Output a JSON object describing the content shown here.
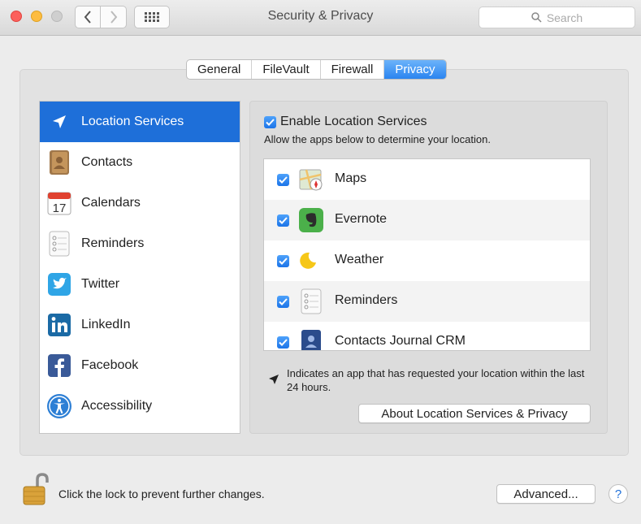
{
  "window": {
    "title": "Security & Privacy"
  },
  "search": {
    "placeholder": "Search"
  },
  "tabs": [
    {
      "label": "General",
      "active": false
    },
    {
      "label": "FileVault",
      "active": false
    },
    {
      "label": "Firewall",
      "active": false
    },
    {
      "label": "Privacy",
      "active": true
    }
  ],
  "sidebar": {
    "items": [
      {
        "label": "Location Services",
        "icon": "location-arrow-icon",
        "active": true
      },
      {
        "label": "Contacts",
        "icon": "contacts-book-icon",
        "active": false
      },
      {
        "label": "Calendars",
        "icon": "calendar-icon",
        "active": false
      },
      {
        "label": "Reminders",
        "icon": "reminders-icon",
        "active": false
      },
      {
        "label": "Twitter",
        "icon": "twitter-icon",
        "active": false
      },
      {
        "label": "LinkedIn",
        "icon": "linkedin-icon",
        "active": false
      },
      {
        "label": "Facebook",
        "icon": "facebook-icon",
        "active": false
      },
      {
        "label": "Accessibility",
        "icon": "accessibility-icon",
        "active": false
      }
    ],
    "calendar_day": "17"
  },
  "panel": {
    "enable_label": "Enable Location Services",
    "enable_checked": true,
    "subtitle": "Allow the apps below to determine your location.",
    "apps": [
      {
        "label": "Maps",
        "checked": true,
        "icon": "maps-icon"
      },
      {
        "label": "Evernote",
        "checked": true,
        "icon": "evernote-icon"
      },
      {
        "label": "Weather",
        "checked": true,
        "icon": "weather-icon"
      },
      {
        "label": "Reminders",
        "checked": true,
        "icon": "reminders-icon"
      },
      {
        "label": "Contacts Journal CRM",
        "checked": true,
        "icon": "contacts-journal-icon"
      }
    ],
    "note": "Indicates an app that has requested your location within the last 24 hours.",
    "about_button": "About Location Services & Privacy"
  },
  "footer": {
    "lock_text": "Click the lock to prevent further changes.",
    "advanced_button": "Advanced...",
    "help_button": "?"
  },
  "colors": {
    "accent": "#1e6fd9",
    "close": "#fc605c",
    "minimize": "#fdbc40"
  }
}
